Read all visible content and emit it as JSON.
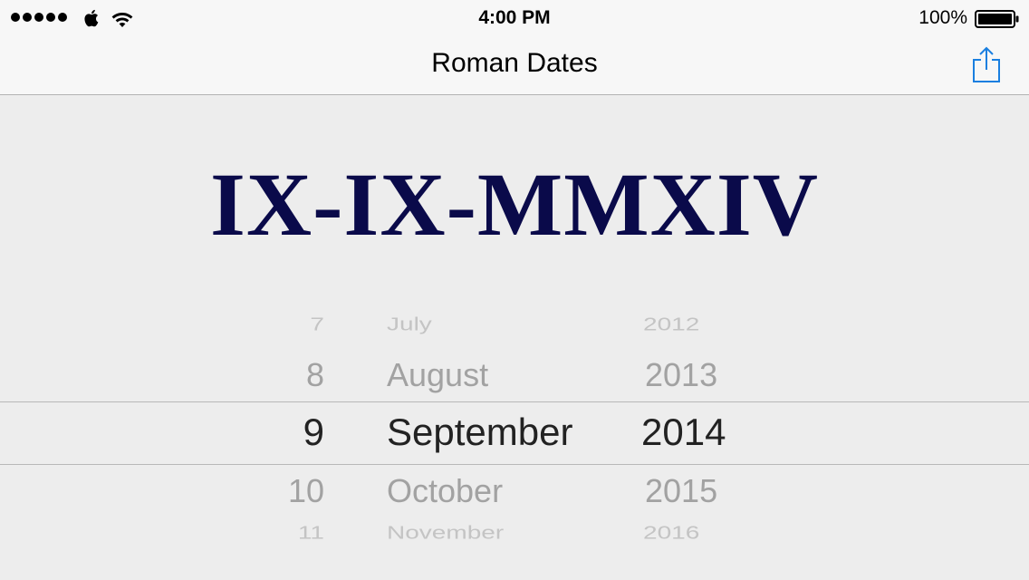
{
  "status_bar": {
    "time": "4:00 PM",
    "battery_percent": "100%",
    "signal_bars": 5,
    "icons": [
      "apple-icon",
      "wifi-icon",
      "battery-icon"
    ]
  },
  "nav": {
    "title": "Roman Dates",
    "action_icon": "share-icon",
    "accent_color": "#1a7fe0"
  },
  "roman_date": {
    "text": "IX-IX-MMXIV",
    "color": "#0a0a4a"
  },
  "picker": {
    "day": {
      "rows": [
        "7",
        "8",
        "9",
        "10",
        "11"
      ],
      "selected": "9"
    },
    "month": {
      "rows": [
        "July",
        "August",
        "September",
        "October",
        "November"
      ],
      "selected": "September"
    },
    "year": {
      "rows": [
        "2012",
        "2013",
        "2014",
        "2015",
        "2016"
      ],
      "selected": "2014"
    }
  }
}
